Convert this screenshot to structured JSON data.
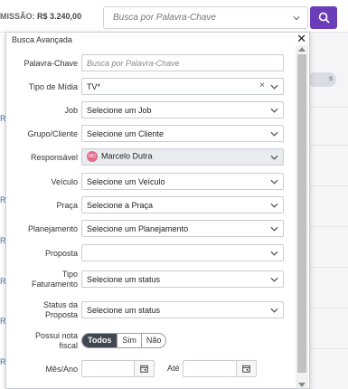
{
  "header": {
    "commission_label": "MISSÃO:",
    "commission_value": "R$ 3.240,00",
    "search_placeholder": "Busca por Palavra-Chave"
  },
  "background": {
    "toggle_label": "s",
    "cut_values": [
      "R$",
      "R$",
      "R$",
      "R$",
      "R$",
      "R$"
    ]
  },
  "panel": {
    "title": "Busca Avançada",
    "fields": {
      "keyword": {
        "label": "Palavra-Chave",
        "placeholder": "Busca por Palavra-Chave"
      },
      "media_type": {
        "label": "Tipo de Mídia",
        "value": "TV*"
      },
      "job": {
        "label": "Job",
        "value": "Selecione um Job"
      },
      "client": {
        "label": "Grupo/Cliente",
        "value": "Selecione um Cliente"
      },
      "owner": {
        "label": "Responsável",
        "value": "Marcelo Dutra",
        "avatar_initials": "MD"
      },
      "vehicle": {
        "label": "Veículo",
        "value": "Selecione um Veículo"
      },
      "market": {
        "label": "Praça",
        "value": "Selecione a Praça"
      },
      "planning": {
        "label": "Planejamento",
        "value": "Selecione um Planejamento"
      },
      "proposal": {
        "label": "Proposta",
        "value": ""
      },
      "billing_type": {
        "label_line1": "Tipo",
        "label_line2": "Faturamento",
        "value": "Selecione um status"
      },
      "proposal_status": {
        "label_line1": "Status da",
        "label_line2": "Proposta",
        "value": "Selecione um status"
      },
      "has_invoice": {
        "label_line1": "Possui nota",
        "label_line2": "fiscal",
        "options": [
          "Todos",
          "Sim",
          "Não"
        ],
        "selected": "Todos"
      },
      "month_year": {
        "label": "Mês/Ano",
        "until_label": "Até"
      }
    }
  },
  "colors": {
    "accent": "#6c3db8",
    "segment_active": "#3f4750",
    "avatar": "#e86a8a"
  }
}
